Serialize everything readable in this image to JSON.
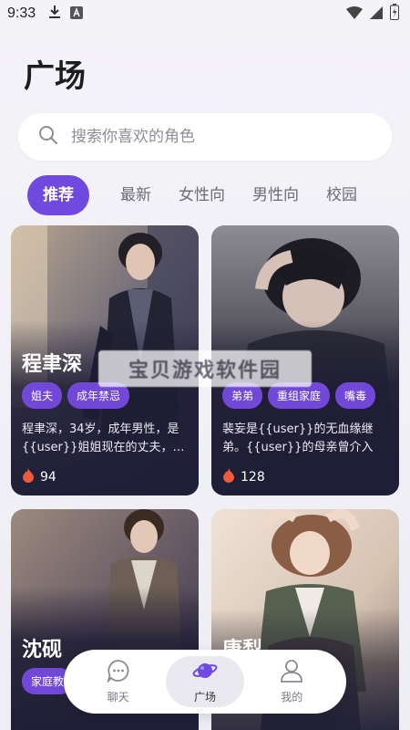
{
  "status_bar": {
    "time": "9:33"
  },
  "page_title": "广场",
  "search": {
    "placeholder": "搜索你喜欢的角色"
  },
  "tabs": [
    {
      "label": "推荐",
      "active": true
    },
    {
      "label": "最新"
    },
    {
      "label": "女性向"
    },
    {
      "label": "男性向"
    },
    {
      "label": "校园"
    }
  ],
  "cards": [
    {
      "name": "程聿深",
      "tags": [
        "姐夫",
        "成年禁忌"
      ],
      "description": "程聿深，34岁，成年男性，是{{user}}姐姐现在的丈夫，…",
      "heat": "94"
    },
    {
      "name": "",
      "tags": [
        "弟弟",
        "重组家庭",
        "嘴毒"
      ],
      "description": "裴妄是{{user}}的无血缘继弟。{{user}}的母亲曾介入他…",
      "heat": "128"
    },
    {
      "name": "沈砚",
      "tags": [
        "家庭教"
      ]
    },
    {
      "name": "唐梨"
    }
  ],
  "watermark": "宝贝游戏软件园",
  "bottom_nav": [
    {
      "label": "聊天",
      "icon": "chat-icon"
    },
    {
      "label": "广场",
      "icon": "planet-icon",
      "active": true
    },
    {
      "label": "我的",
      "icon": "profile-icon"
    }
  ],
  "colors": {
    "accent": "#6f49e0",
    "tag": "#7248d9",
    "card_dark": "#1e1e36"
  }
}
